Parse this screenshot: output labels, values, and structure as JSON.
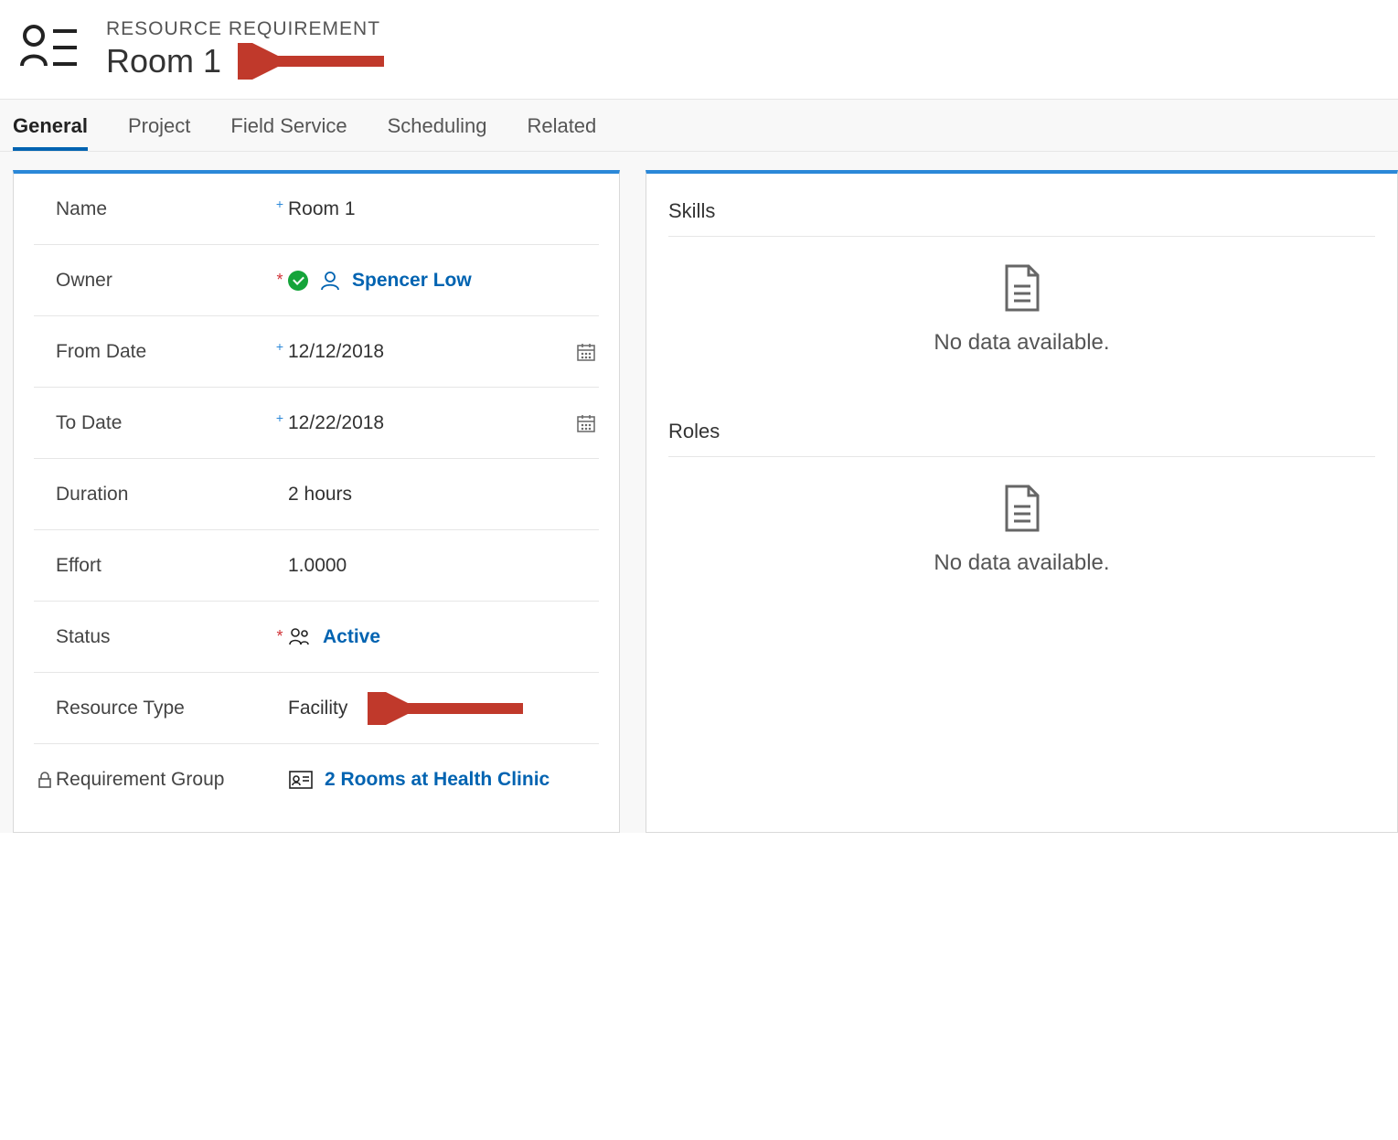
{
  "header": {
    "subtitle": "RESOURCE REQUIREMENT",
    "title": "Room 1"
  },
  "tabs": [
    {
      "label": "General",
      "active": true
    },
    {
      "label": "Project",
      "active": false
    },
    {
      "label": "Field Service",
      "active": false
    },
    {
      "label": "Scheduling",
      "active": false
    },
    {
      "label": "Related",
      "active": false
    }
  ],
  "fields": {
    "name": {
      "label": "Name",
      "value": "Room 1"
    },
    "owner": {
      "label": "Owner",
      "value": "Spencer Low"
    },
    "from_date": {
      "label": "From Date",
      "value": "12/12/2018"
    },
    "to_date": {
      "label": "To Date",
      "value": "12/22/2018"
    },
    "duration": {
      "label": "Duration",
      "value": "2 hours"
    },
    "effort": {
      "label": "Effort",
      "value": "1.0000"
    },
    "status": {
      "label": "Status",
      "value": "Active"
    },
    "resource_type": {
      "label": "Resource Type",
      "value": "Facility"
    },
    "requirement_group": {
      "label": "Requirement Group",
      "value": "2 Rooms at Health Clinic"
    }
  },
  "side_sections": {
    "skills": {
      "title": "Skills",
      "empty_msg": "No data available."
    },
    "roles": {
      "title": "Roles",
      "empty_msg": "No data available."
    }
  }
}
